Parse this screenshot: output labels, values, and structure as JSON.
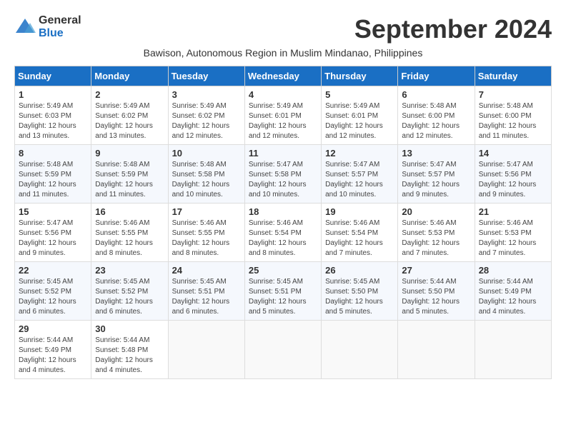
{
  "header": {
    "logo_general": "General",
    "logo_blue": "Blue",
    "month_title": "September 2024",
    "subtitle": "Bawison, Autonomous Region in Muslim Mindanao, Philippines"
  },
  "days_of_week": [
    "Sunday",
    "Monday",
    "Tuesday",
    "Wednesday",
    "Thursday",
    "Friday",
    "Saturday"
  ],
  "weeks": [
    [
      {
        "day": "1",
        "sunrise": "5:49 AM",
        "sunset": "6:03 PM",
        "daylight": "12 hours and 13 minutes."
      },
      {
        "day": "2",
        "sunrise": "5:49 AM",
        "sunset": "6:02 PM",
        "daylight": "12 hours and 13 minutes."
      },
      {
        "day": "3",
        "sunrise": "5:49 AM",
        "sunset": "6:02 PM",
        "daylight": "12 hours and 12 minutes."
      },
      {
        "day": "4",
        "sunrise": "5:49 AM",
        "sunset": "6:01 PM",
        "daylight": "12 hours and 12 minutes."
      },
      {
        "day": "5",
        "sunrise": "5:49 AM",
        "sunset": "6:01 PM",
        "daylight": "12 hours and 12 minutes."
      },
      {
        "day": "6",
        "sunrise": "5:48 AM",
        "sunset": "6:00 PM",
        "daylight": "12 hours and 12 minutes."
      },
      {
        "day": "7",
        "sunrise": "5:48 AM",
        "sunset": "6:00 PM",
        "daylight": "12 hours and 11 minutes."
      }
    ],
    [
      {
        "day": "8",
        "sunrise": "5:48 AM",
        "sunset": "5:59 PM",
        "daylight": "12 hours and 11 minutes."
      },
      {
        "day": "9",
        "sunrise": "5:48 AM",
        "sunset": "5:59 PM",
        "daylight": "12 hours and 11 minutes."
      },
      {
        "day": "10",
        "sunrise": "5:48 AM",
        "sunset": "5:58 PM",
        "daylight": "12 hours and 10 minutes."
      },
      {
        "day": "11",
        "sunrise": "5:47 AM",
        "sunset": "5:58 PM",
        "daylight": "12 hours and 10 minutes."
      },
      {
        "day": "12",
        "sunrise": "5:47 AM",
        "sunset": "5:57 PM",
        "daylight": "12 hours and 10 minutes."
      },
      {
        "day": "13",
        "sunrise": "5:47 AM",
        "sunset": "5:57 PM",
        "daylight": "12 hours and 9 minutes."
      },
      {
        "day": "14",
        "sunrise": "5:47 AM",
        "sunset": "5:56 PM",
        "daylight": "12 hours and 9 minutes."
      }
    ],
    [
      {
        "day": "15",
        "sunrise": "5:47 AM",
        "sunset": "5:56 PM",
        "daylight": "12 hours and 9 minutes."
      },
      {
        "day": "16",
        "sunrise": "5:46 AM",
        "sunset": "5:55 PM",
        "daylight": "12 hours and 8 minutes."
      },
      {
        "day": "17",
        "sunrise": "5:46 AM",
        "sunset": "5:55 PM",
        "daylight": "12 hours and 8 minutes."
      },
      {
        "day": "18",
        "sunrise": "5:46 AM",
        "sunset": "5:54 PM",
        "daylight": "12 hours and 8 minutes."
      },
      {
        "day": "19",
        "sunrise": "5:46 AM",
        "sunset": "5:54 PM",
        "daylight": "12 hours and 7 minutes."
      },
      {
        "day": "20",
        "sunrise": "5:46 AM",
        "sunset": "5:53 PM",
        "daylight": "12 hours and 7 minutes."
      },
      {
        "day": "21",
        "sunrise": "5:46 AM",
        "sunset": "5:53 PM",
        "daylight": "12 hours and 7 minutes."
      }
    ],
    [
      {
        "day": "22",
        "sunrise": "5:45 AM",
        "sunset": "5:52 PM",
        "daylight": "12 hours and 6 minutes."
      },
      {
        "day": "23",
        "sunrise": "5:45 AM",
        "sunset": "5:52 PM",
        "daylight": "12 hours and 6 minutes."
      },
      {
        "day": "24",
        "sunrise": "5:45 AM",
        "sunset": "5:51 PM",
        "daylight": "12 hours and 6 minutes."
      },
      {
        "day": "25",
        "sunrise": "5:45 AM",
        "sunset": "5:51 PM",
        "daylight": "12 hours and 5 minutes."
      },
      {
        "day": "26",
        "sunrise": "5:45 AM",
        "sunset": "5:50 PM",
        "daylight": "12 hours and 5 minutes."
      },
      {
        "day": "27",
        "sunrise": "5:44 AM",
        "sunset": "5:50 PM",
        "daylight": "12 hours and 5 minutes."
      },
      {
        "day": "28",
        "sunrise": "5:44 AM",
        "sunset": "5:49 PM",
        "daylight": "12 hours and 4 minutes."
      }
    ],
    [
      {
        "day": "29",
        "sunrise": "5:44 AM",
        "sunset": "5:49 PM",
        "daylight": "12 hours and 4 minutes."
      },
      {
        "day": "30",
        "sunrise": "5:44 AM",
        "sunset": "5:48 PM",
        "daylight": "12 hours and 4 minutes."
      },
      null,
      null,
      null,
      null,
      null
    ]
  ],
  "labels": {
    "sunrise": "Sunrise:",
    "sunset": "Sunset:",
    "daylight": "Daylight:"
  }
}
